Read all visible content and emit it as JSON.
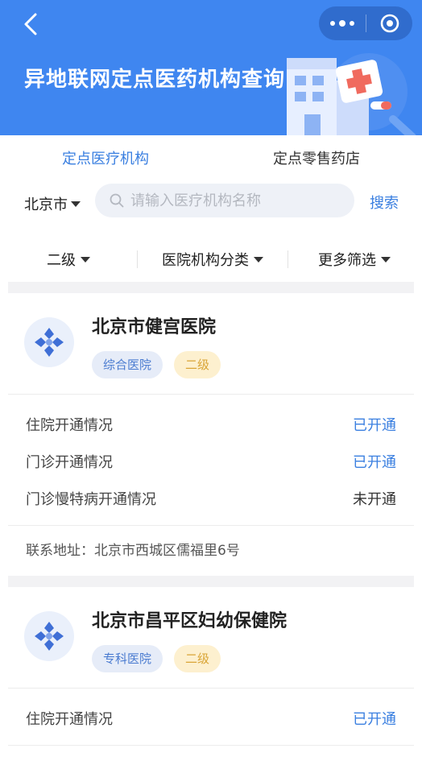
{
  "header": {
    "title": "异地联网定点医药机构查询",
    "back_icon": "chevron-left-icon",
    "more_icon": "more-dots-icon",
    "target_icon": "target-icon",
    "color": "#3f86f0"
  },
  "tabs": [
    {
      "label": "定点医疗机构",
      "active": true
    },
    {
      "label": "定点零售药店",
      "active": false
    }
  ],
  "search": {
    "city": "北京市",
    "placeholder": "请输入医疗机构名称",
    "value": "",
    "button_label": "搜索"
  },
  "filters": [
    {
      "label": "二级"
    },
    {
      "label": "医院机构分类"
    },
    {
      "label": "更多筛选"
    }
  ],
  "institutions": [
    {
      "name": "北京市健宫医院",
      "tags": [
        "综合医院",
        "二级"
      ],
      "services": [
        {
          "label": "住院开通情况",
          "status": "已开通"
        },
        {
          "label": "门诊开通情况",
          "status": "已开通"
        },
        {
          "label": "门诊慢特病开通情况",
          "status": "未开通"
        }
      ],
      "address": "联系地址：北京市西城区儒福里6号"
    },
    {
      "name": "北京市昌平区妇幼保健院",
      "tags": [
        "专科医院",
        "二级"
      ],
      "services": [
        {
          "label": "住院开通情况",
          "status": "已开通"
        }
      ]
    }
  ],
  "colors": {
    "accent": "#3a7fe0",
    "tag_blue": "#4a7bd0",
    "tag_yellow": "#d9a537"
  }
}
